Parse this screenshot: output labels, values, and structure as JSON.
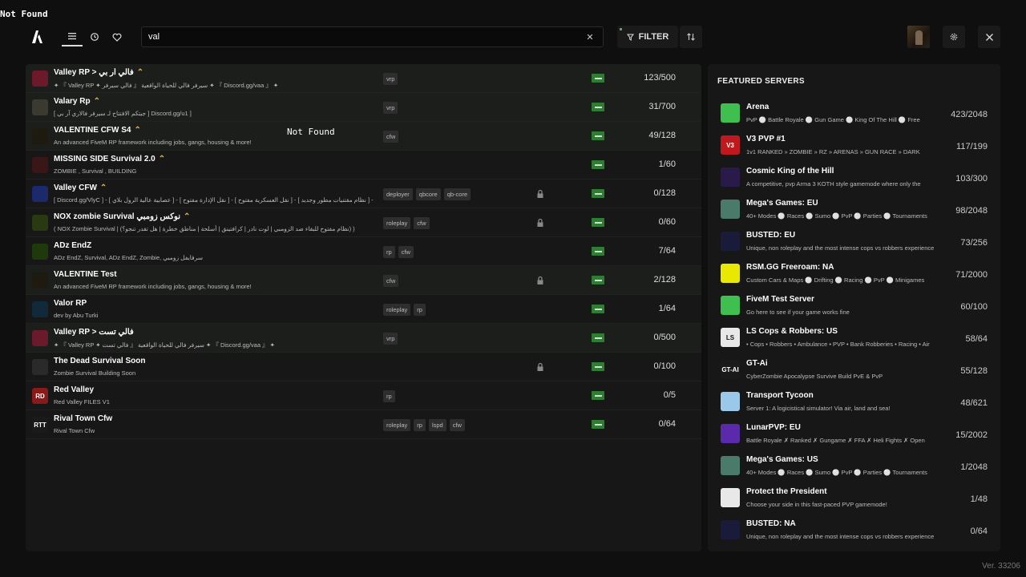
{
  "page_notice": "Not Found",
  "overlay_notice": "Not Found",
  "nav": [
    {
      "name": "list-view",
      "icon": "list-icon",
      "active": true
    },
    {
      "name": "history",
      "icon": "history-icon",
      "active": false
    },
    {
      "name": "favorites",
      "icon": "heart-icon",
      "active": false
    }
  ],
  "search": {
    "value": "val"
  },
  "filter_label": "FILTER",
  "servers": [
    {
      "name": "Valley RP > فالي ار بي",
      "desc": "✦ 『 Valley RP ✦ فالي سيرفر 』 سيرفر فالي للحياة الواقعية ✦ 『 Discord.gg/vaa 』 ✦",
      "tags": [
        "vrp"
      ],
      "locked": false,
      "players": "123/500",
      "star": true,
      "icon": "valley-icon",
      "iconColor": "#6a1a2a",
      "highlight": true
    },
    {
      "name": "Valary Rp",
      "desc": "[ جيتكم الافتتاح لـ سيرفر فالاري آر بي ] Discord.gg/u1 ]",
      "tags": [
        "vrp"
      ],
      "locked": false,
      "players": "31/700",
      "star": true,
      "icon": "valary-icon",
      "iconColor": "#3a3a30",
      "highlight": true
    },
    {
      "name": "VALENTINE CFW S4",
      "desc": "An advanced FiveM RP framework including jobs, gangs, housing & more!",
      "tags": [
        "cfw"
      ],
      "locked": false,
      "players": "49/128",
      "star": true,
      "icon": "valentine-icon",
      "iconColor": "#1e1a10",
      "highlight": true
    },
    {
      "name": "MISSING SIDE Survival 2.0",
      "desc": "ZOMBIE , Survival , BUILDING",
      "tags": [],
      "locked": false,
      "players": "1/60",
      "star": true,
      "icon": "missing-side-icon",
      "iconColor": "#3a1616",
      "highlight": false
    },
    {
      "name": "Valley CFW",
      "desc": "[ Discord.gg/VlyC ] - [ عصابية عالية الرول بلاي ] - [ نقل الإدارة مفتوح ] - [ نقل العسكرية مفتوح ] - [ نظام مقتنيات مطور وجديد ] - عرض",
      "tags": [
        "deployer",
        "qbcore",
        "qb-core"
      ],
      "locked": true,
      "players": "0/128",
      "star": true,
      "icon": "valley-cfw-icon",
      "iconColor": "#1a2a6a",
      "highlight": false
    },
    {
      "name": "NOX zombie Survival نوكس زومبي",
      "desc": "( NOX Zombie Survival | (نظام مفتوح للبقاء ضد الزومبي | لوت نادر | كرافتينق | أسلحة | مناطق خطرة | هل تقدر تنجو؟) )",
      "tags": [
        "roleplay",
        "cfw"
      ],
      "locked": true,
      "players": "0/60",
      "star": true,
      "icon": "nox-icon",
      "iconColor": "#2a3a10",
      "highlight": false
    },
    {
      "name": "ADz EndZ",
      "desc": "ADz EndZ, Survival, ADz EndZ, Zombie, سرفايفل زومبي",
      "tags": [
        "rp",
        "cfw"
      ],
      "locked": false,
      "players": "7/64",
      "star": false,
      "icon": "adz-icon",
      "iconColor": "#1e3a0a",
      "highlight": false
    },
    {
      "name": "VALENTINE Test",
      "desc": "An advanced FiveM RP framework including jobs, gangs, housing & more!",
      "tags": [
        "cfw"
      ],
      "locked": true,
      "players": "2/128",
      "star": false,
      "icon": "valentine-test-icon",
      "iconColor": "#1e1a10",
      "highlight": true
    },
    {
      "name": "Valor RP",
      "desc": "dev by Abu Turki",
      "tags": [
        "roleplay",
        "rp"
      ],
      "locked": false,
      "players": "1/64",
      "star": false,
      "icon": "valor-icon",
      "iconColor": "#102a3a",
      "highlight": false
    },
    {
      "name": "Valley RP > فالي تست",
      "desc": "✦ 『 Valley RP ✦ فالي تست 』 سيرفر فالي للحياة الواقعية ✦ 『 Discord.gg/vaa 』 ✦",
      "tags": [
        "vrp"
      ],
      "locked": false,
      "players": "0/500",
      "star": false,
      "icon": "valley-test-icon",
      "iconColor": "#6a1a2a",
      "highlight": true
    },
    {
      "name": "The Dead Survival Soon",
      "desc": "Zombie Survival Building Soon",
      "tags": [],
      "locked": true,
      "players": "0/100",
      "star": false,
      "icon": "dead-survival-icon",
      "iconColor": "#2a2a2a",
      "highlight": false
    },
    {
      "name": "Red Valley",
      "desc": "Red Valley FILES V1",
      "tags": [
        "rp"
      ],
      "locked": false,
      "players": "0/5",
      "star": false,
      "icon": "red-valley-icon",
      "iconColor": "#8a1a1a",
      "iconText": "RD",
      "highlight": false
    },
    {
      "name": "Rival Town Cfw",
      "desc": "Rival Town Cfw",
      "tags": [
        "roleplay",
        "rp",
        "lspd",
        "cfw"
      ],
      "locked": false,
      "players": "0/64",
      "star": false,
      "icon": "rival-town-icon",
      "iconColor": "#1a1a1a",
      "iconText": "RTT",
      "highlight": false
    }
  ],
  "featured": {
    "title": "FEATURED SERVERS",
    "items": [
      {
        "name": "Arena",
        "desc": "PvP ⚪ Battle Royale ⚪ Gun Game ⚪ King Of The Hill ⚪ Free",
        "players": "423/2048",
        "icon": "arena-icon",
        "iconColor": "#3fbf4f"
      },
      {
        "name": "V3 PVP #1",
        "desc": "1v1 RANKED » ZOMBIE » RZ » ARENAS » GUN RACE » DARK",
        "players": "117/199",
        "icon": "v3-icon",
        "iconColor": "#c0181c",
        "iconText": "V3"
      },
      {
        "name": "Cosmic King of the Hill",
        "desc": "A competitive, pvp Arma 3 KOTH style gamemode where only the",
        "players": "103/300",
        "icon": "cosmic-icon",
        "iconColor": "#2a1a4a"
      },
      {
        "name": "Mega's Games: EU",
        "desc": "40+ Modes ⚪ Races ⚪ Sumo ⚪ PvP ⚪ Parties ⚪ Tournaments",
        "players": "98/2048",
        "icon": "megas-icon",
        "iconColor": "#4a7a6a"
      },
      {
        "name": "BUSTED: EU",
        "desc": "Unique, non roleplay and the most intense cops vs robbers experience",
        "players": "73/256",
        "icon": "busted-icon",
        "iconColor": "#1a1a3a"
      },
      {
        "name": "RSM.GG Freeroam: NA",
        "desc": "Custom Cars & Maps ⚪ Drifting ⚪ Racing ⚪ PvP ⚪ Minigames",
        "players": "71/2000",
        "icon": "rsm-icon",
        "iconColor": "#e8e800"
      },
      {
        "name": "FiveM Test Server",
        "desc": "Go here to see if your game works fine",
        "players": "60/100",
        "icon": "fivem-icon",
        "iconColor": "#3fbf4f"
      },
      {
        "name": "LS Cops & Robbers: US",
        "desc": "• Cops • Robbers • Ambulance • PVP • Bank Robberies • Racing • Air",
        "players": "58/64",
        "icon": "ls-cops-icon",
        "iconColor": "#e8e8e8",
        "iconText": "LS"
      },
      {
        "name": "GT-Ai",
        "desc": "CyberZombie Apocalypse Survive Build PvE & PvP",
        "players": "55/128",
        "icon": "gt-ai-icon",
        "iconColor": "#1a1a1a",
        "iconText": "GT-AI"
      },
      {
        "name": "Transport Tycoon",
        "desc": "Server 1: A logicistical simulator! Via air, land and sea!",
        "players": "48/621",
        "icon": "transport-icon",
        "iconColor": "#9ac8e8"
      },
      {
        "name": "LunarPVP: EU",
        "desc": "Battle Royale ✗ Ranked ✗ Gungame ✗ FFA ✗ Heli Fights ✗ Open",
        "players": "15/2002",
        "icon": "lunar-icon",
        "iconColor": "#5a2aaa"
      },
      {
        "name": "Mega's Games: US",
        "desc": "40+ Modes ⚪ Races ⚪ Sumo ⚪ PvP ⚪ Parties ⚪ Tournaments",
        "players": "1/2048",
        "icon": "megas-us-icon",
        "iconColor": "#4a7a6a"
      },
      {
        "name": "Protect the President",
        "desc": "Choose your side in this fast-paced PVP gamemode!",
        "players": "1/48",
        "icon": "president-icon",
        "iconColor": "#e8e8e8"
      },
      {
        "name": "BUSTED: NA",
        "desc": "Unique, non roleplay and the most intense cops vs robbers experience",
        "players": "0/64",
        "icon": "busted-na-icon",
        "iconColor": "#1a1a3a"
      }
    ]
  },
  "version": "Ver. 33206"
}
